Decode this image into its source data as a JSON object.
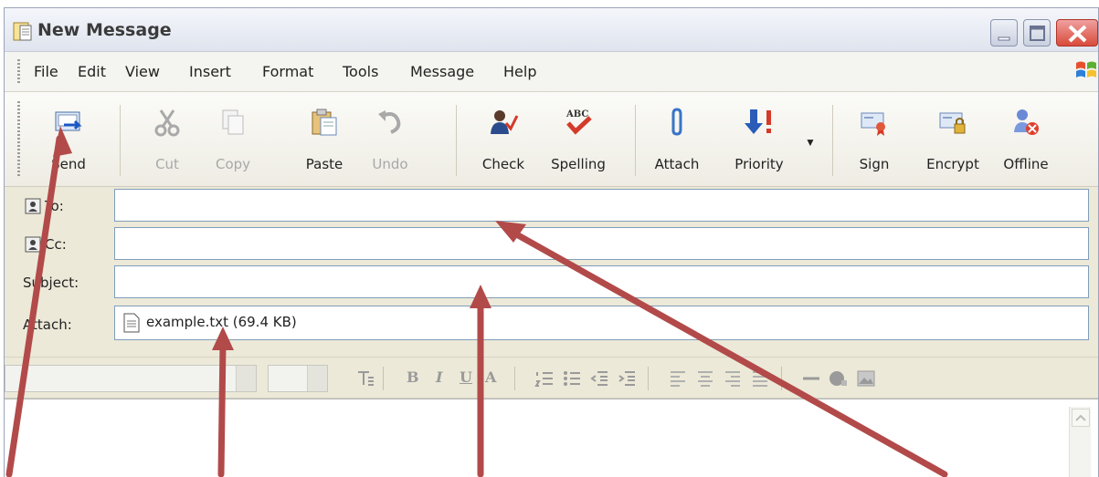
{
  "window": {
    "title": "New Message",
    "controls": {
      "minimize": "minimize",
      "maximize": "maximize",
      "close": "close"
    }
  },
  "menu": [
    "File",
    "Edit",
    "View",
    "Insert",
    "Format",
    "Tools",
    "Message",
    "Help"
  ],
  "toolbar": {
    "send": "Send",
    "cut": "Cut",
    "copy": "Copy",
    "paste": "Paste",
    "undo": "Undo",
    "check": "Check",
    "spelling": "Spelling",
    "attach": "Attach",
    "priority": "Priority",
    "sign": "Sign",
    "encrypt": "Encrypt",
    "offline": "Offline"
  },
  "fields": {
    "to_label": "To:",
    "to_value": "",
    "cc_label": "Cc:",
    "cc_value": "",
    "subject_label": "Subject:",
    "subject_value": "",
    "attach_label": "Attach:",
    "attachment": "example.txt (69.4 KB)"
  },
  "colors": {
    "window_bg": "#ece9d8",
    "close_button": "#d84b3a",
    "annotation_arrow": "#b24a4a",
    "field_border": "#7f9db9"
  },
  "icons": {
    "send": "send-icon",
    "cut": "scissors-icon",
    "copy": "copy-icon",
    "paste": "paste-icon",
    "undo": "undo-icon",
    "check": "check-names-icon",
    "spelling": "spelling-icon",
    "attach": "paperclip-icon",
    "priority": "priority-icon",
    "sign": "sign-icon",
    "encrypt": "encrypt-icon",
    "offline": "offline-icon"
  }
}
